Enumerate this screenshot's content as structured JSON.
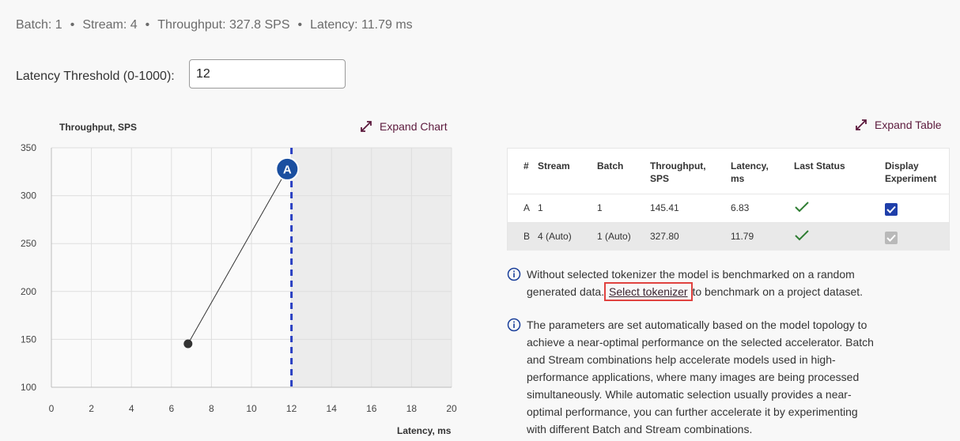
{
  "summary": {
    "batch": "Batch: 1",
    "stream": "Stream: 4",
    "throughput": "Throughput: 327.8  SPS",
    "latency": "Latency: 11.79 ms",
    "separator": "•"
  },
  "threshold": {
    "label": "Latency Threshold (0-1000):",
    "value": "12"
  },
  "chart": {
    "expand_label": "Expand Chart",
    "ylabel": "Throughput, SPS",
    "xlabel": "Latency, ms"
  },
  "chart_data": {
    "type": "scatter",
    "xlabel": "Latency, ms",
    "ylabel": "Throughput, SPS",
    "xlim": [
      0,
      20
    ],
    "ylim": [
      100,
      350
    ],
    "xticks": [
      0,
      2,
      4,
      6,
      8,
      10,
      12,
      14,
      16,
      18,
      20
    ],
    "yticks": [
      100,
      150,
      200,
      250,
      300,
      350
    ],
    "grid": true,
    "threshold_x": 12,
    "points": [
      {
        "label": "A",
        "x": 11.79,
        "y": 327.8,
        "highlighted": true
      },
      {
        "label": "",
        "x": 6.83,
        "y": 145.41,
        "highlighted": false
      }
    ],
    "colors": {
      "threshold": "#2a40c2",
      "point_a": "#1a4fa0",
      "shaded": "#ececec"
    }
  },
  "table": {
    "expand_label": "Expand Table",
    "headers": [
      "#",
      "Stream",
      "Batch",
      "Throughput, SPS",
      "Latency, ms",
      "Last Status",
      "Display Experiment"
    ],
    "header_lines": {
      "throughput": [
        "Throughput,",
        "SPS"
      ],
      "latency": [
        "Latency,",
        "ms"
      ],
      "display": [
        "Display",
        "Experiment"
      ]
    },
    "rows": [
      {
        "id": "A",
        "stream": "1",
        "batch": "1",
        "throughput": "145.41",
        "latency": "6.83",
        "status": "success",
        "display": "checked"
      },
      {
        "id": "B",
        "stream": "4 (Auto)",
        "batch": "1 (Auto)",
        "throughput": "327.80",
        "latency": "11.79",
        "status": "success",
        "display": "checked-disabled"
      }
    ]
  },
  "info1": {
    "before": "Without selected tokenizer the model is benchmarked on a random generated data.",
    "link": "Select tokenizer",
    "after": "to benchmark on a project dataset."
  },
  "info2": {
    "text": "The parameters are set automatically based on the model topology to achieve a near-optimal performance on the selected accelerator. Batch and Stream combinations help accelerate models used in high-performance applications, where many images are being processed simultaneously. While automatic selection usually provides a near-optimal performance, you can further accelerate it by experimenting with different Batch and Stream combinations."
  },
  "icons": {
    "expand": "expand-arrows-icon",
    "info": "info-circle-icon",
    "status": "checkmark-icon",
    "display": "checkbox-icon"
  }
}
